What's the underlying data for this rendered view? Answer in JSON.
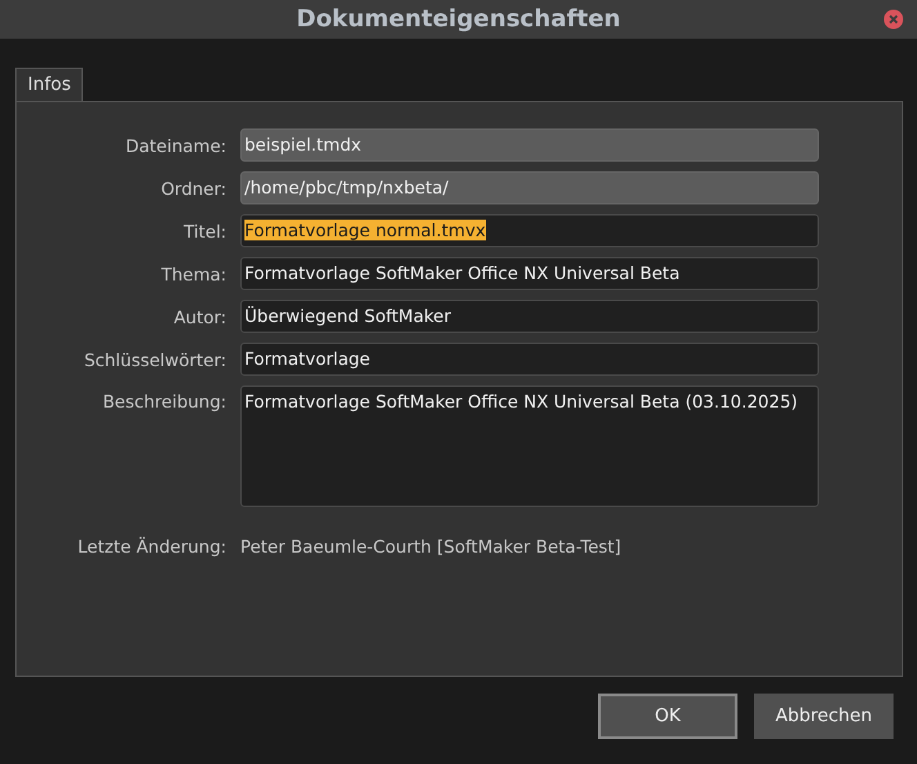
{
  "window": {
    "title": "Dokumenteigenschaften"
  },
  "tabs": [
    {
      "label": "Infos",
      "selected": true
    }
  ],
  "fields": [
    {
      "label": "Dateiname:",
      "value": "beispiel.tmdx",
      "kind": "readonly",
      "text_selected": false
    },
    {
      "label": "Ordner:",
      "value": "/home/pbc/tmp/nxbeta/",
      "kind": "readonly",
      "text_selected": false
    },
    {
      "label": "Titel:",
      "value": "Formatvorlage normal.tmvx",
      "kind": "editable",
      "text_selected": true
    },
    {
      "label": "Thema:",
      "value": "Formatvorlage SoftMaker Office NX Universal Beta",
      "kind": "editable",
      "text_selected": false
    },
    {
      "label": "Autor:",
      "value": "Überwiegend SoftMaker",
      "kind": "editable",
      "text_selected": false
    },
    {
      "label": "Schlüsselwörter:",
      "value": "Formatvorlage",
      "kind": "editable",
      "text_selected": false
    },
    {
      "label": "Beschreibung:",
      "value": "Formatvorlage SoftMaker Office NX Universal Beta (03.10.2025)",
      "kind": "multiline",
      "text_selected": false
    }
  ],
  "last_change": {
    "label": "Letzte Änderung:",
    "value": "Peter Baeumle-Courth [SoftMaker Beta-Test]"
  },
  "buttons": [
    {
      "label": "OK",
      "default": true
    },
    {
      "label": "Abbrechen",
      "default": false
    }
  ]
}
